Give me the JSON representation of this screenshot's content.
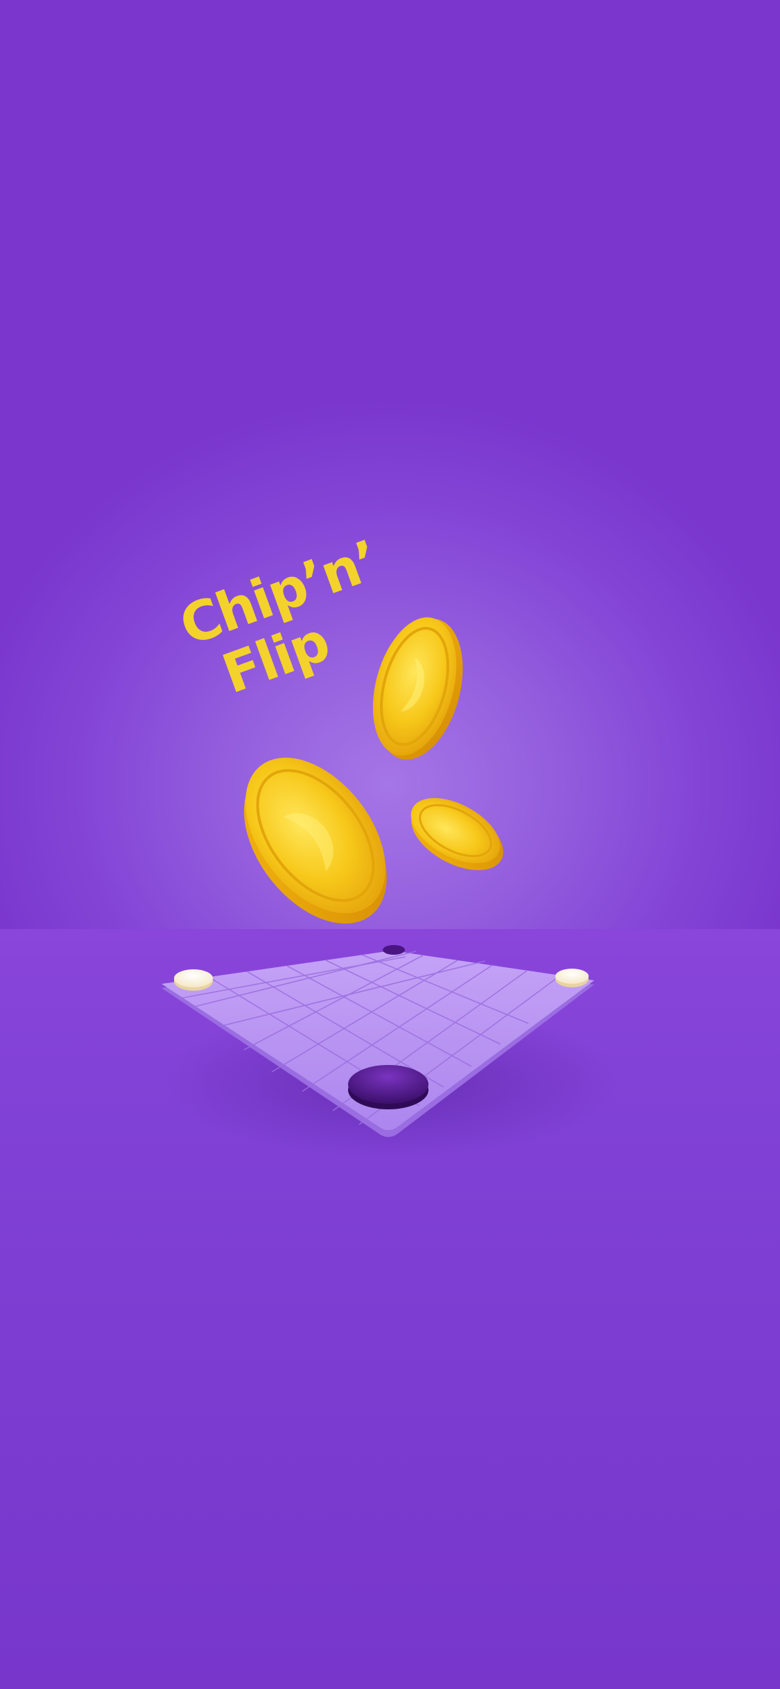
{
  "app": {
    "title_line1": "Chip’n’",
    "title_line2": "Flip"
  },
  "colors": {
    "background_top": "#7433c9",
    "background_center": "#a576e6",
    "background_bottom": "#7836cb",
    "board_surface": "#b895f2",
    "board_edge": "#9b72e6",
    "grid_line": "#9d70e0",
    "logo_yellow": "#f4d22c",
    "coin_gold": "#f2c20e",
    "coin_highlight": "#ffe24a",
    "chip_white": "#fff6df",
    "chip_purple": "#4a1582"
  },
  "icons": {
    "coins": [
      "gold-coin-icon",
      "gold-coin-icon",
      "gold-coin-icon"
    ],
    "board_chips": [
      "white-chip-icon",
      "white-chip-icon",
      "purple-chip-icon",
      "purple-chip-icon"
    ]
  }
}
